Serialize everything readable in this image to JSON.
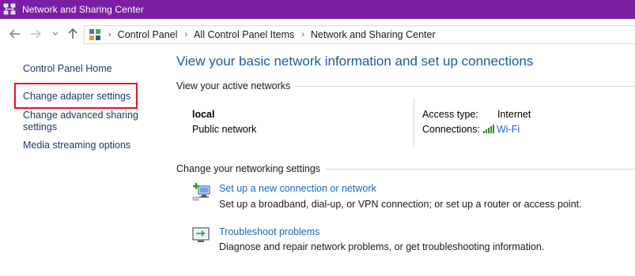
{
  "window": {
    "title": "Network and Sharing Center"
  },
  "nav": {
    "back_icon": "back-arrow-icon",
    "forward_icon": "forward-arrow-icon",
    "recent_icon": "chevron-down-icon",
    "up_icon": "up-arrow-icon",
    "breadcrumb": [
      "Control Panel",
      "All Control Panel Items",
      "Network and Sharing Center"
    ]
  },
  "sidebar": {
    "items": [
      {
        "label": "Control Panel Home"
      },
      {
        "label": "Change adapter settings",
        "highlighted": true
      },
      {
        "label_line1": "Change advanced sharing",
        "label_line2": "settings"
      },
      {
        "label": "Media streaming options"
      }
    ]
  },
  "main": {
    "title": "View your basic network information and set up connections",
    "active_networks": {
      "heading": "View your active networks",
      "name": "local",
      "type": "Public network",
      "access_type_label": "Access type:",
      "access_type_value": "Internet",
      "connections_label": "Connections:",
      "connections_value": "Wi-Fi"
    },
    "networking_settings": {
      "heading": "Change your networking settings",
      "tasks": [
        {
          "icon": "new-connection-icon",
          "link": "Set up a new connection or network",
          "description": "Set up a broadband, dial-up, or VPN connection; or set up a router or access point."
        },
        {
          "icon": "troubleshoot-icon",
          "link": "Troubleshoot problems",
          "description": "Diagnose and repair network problems, or get troubleshooting information."
        }
      ]
    }
  },
  "colors": {
    "titlebar": "#7a1fa2",
    "title_text": "#1e5a9a",
    "link": "#1a67c2",
    "highlight_box": "#e8141b"
  }
}
